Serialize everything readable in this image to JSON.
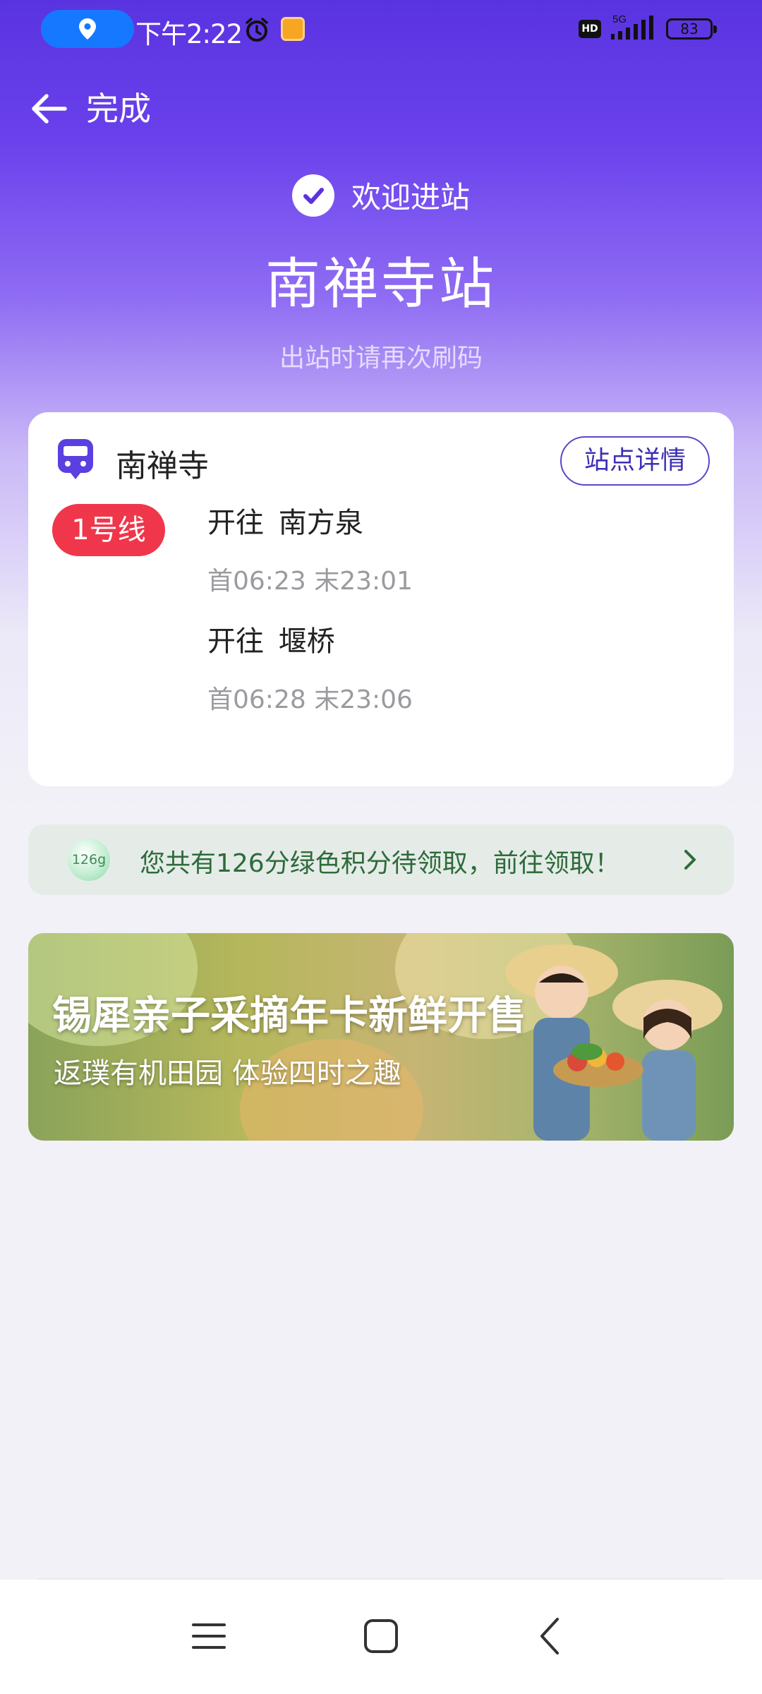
{
  "status_bar": {
    "time": "下午2:22",
    "network": "5G",
    "hd_label": "HD",
    "battery": "83",
    "icons": [
      "location-icon",
      "alarm-icon",
      "note-icon",
      "hd-icon",
      "signal-icon",
      "battery-icon"
    ]
  },
  "header": {
    "back_icon": "arrow-left-icon",
    "done_label": "完成"
  },
  "hero": {
    "welcome": "欢迎进站",
    "station_name": "南禅寺站",
    "hint": "出站时请再次刷码"
  },
  "card": {
    "station": "南禅寺",
    "detail_button": "站点详情",
    "line_badge": "1号线",
    "line_color": "#f0364a",
    "directions": [
      {
        "label": "开往",
        "destination": "南方泉",
        "first": "首06:23",
        "last": "末23:01"
      },
      {
        "label": "开往",
        "destination": "堰桥",
        "first": "首06:28",
        "last": "末23:06"
      }
    ]
  },
  "points": {
    "badge": "126g",
    "text": "您共有126分绿色积分待领取，前往领取！"
  },
  "banner": {
    "title": "锡犀亲子采摘年卡新鲜开售",
    "subtitle": "返璞有机田园  体验四时之趣"
  },
  "colors": {
    "accent": "#5a33e0",
    "detail_border": "#5b47c9",
    "points_text": "#2e6b3a"
  },
  "nav": {
    "icons": [
      "menu-icon",
      "home-icon",
      "back-icon"
    ]
  }
}
